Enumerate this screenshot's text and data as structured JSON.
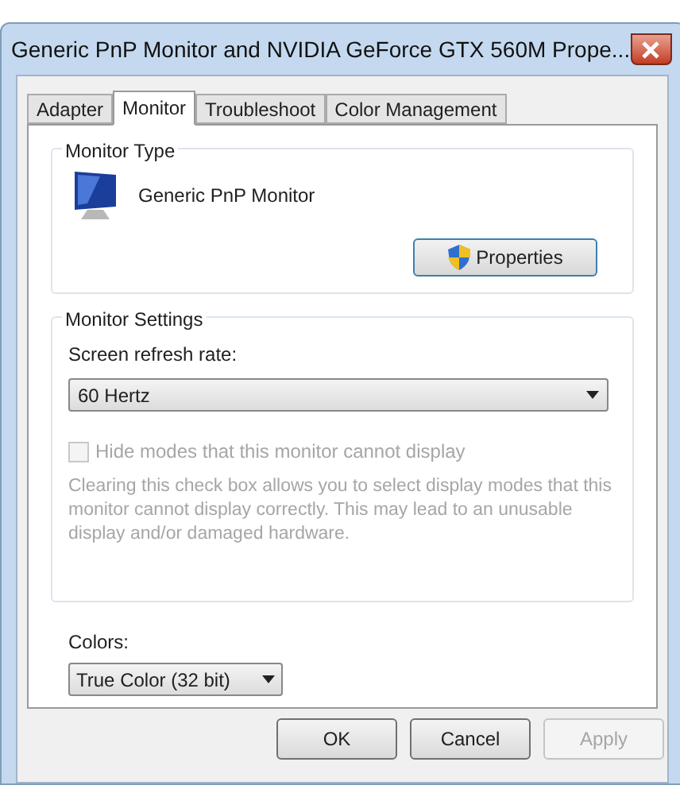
{
  "window": {
    "title": "Generic PnP Monitor and NVIDIA GeForce GTX 560M   Prope..."
  },
  "tabs": [
    {
      "label": "Adapter",
      "selected": false
    },
    {
      "label": "Monitor",
      "selected": true
    },
    {
      "label": "Troubleshoot",
      "selected": false
    },
    {
      "label": "Color Management",
      "selected": false
    }
  ],
  "monitor_type": {
    "title": "Monitor Type",
    "name": "Generic PnP Monitor",
    "button": "Properties"
  },
  "monitor_settings": {
    "title": "Monitor Settings",
    "refresh_label": "Screen refresh rate:",
    "refresh_value": "60 Hertz",
    "checkbox": {
      "label": "Hide modes that this monitor cannot display",
      "checked": false,
      "disabled": true
    },
    "note": "Clearing this check box allows you to select display modes that this monitor cannot display correctly. This may lead to an unusable display and/or damaged hardware.",
    "note_disabled": true
  },
  "colors": {
    "label": "Colors:",
    "value": "True Color (32 bit)"
  },
  "buttons": [
    {
      "label": "OK",
      "disabled": false
    },
    {
      "label": "Cancel",
      "disabled": false
    },
    {
      "label": "Apply",
      "disabled": true
    }
  ]
}
